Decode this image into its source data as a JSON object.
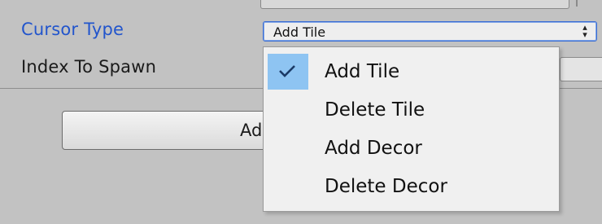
{
  "inspector": {
    "cursor_type_label": "Cursor Type",
    "index_label": "Index To Spawn",
    "cursor_type_value": "Add Tile",
    "button_label": "Add C"
  },
  "dropdown": {
    "selected_index": 0,
    "items": [
      {
        "label": "Add Tile",
        "checked": true
      },
      {
        "label": "Delete Tile",
        "checked": false
      },
      {
        "label": "Add Decor",
        "checked": false
      },
      {
        "label": "Delete Decor",
        "checked": false
      }
    ]
  },
  "colors": {
    "background": "#c2c2c2",
    "active_label": "#2255cc",
    "menu_background": "#f0f0f0",
    "check_highlight": "#8ec4f2"
  }
}
